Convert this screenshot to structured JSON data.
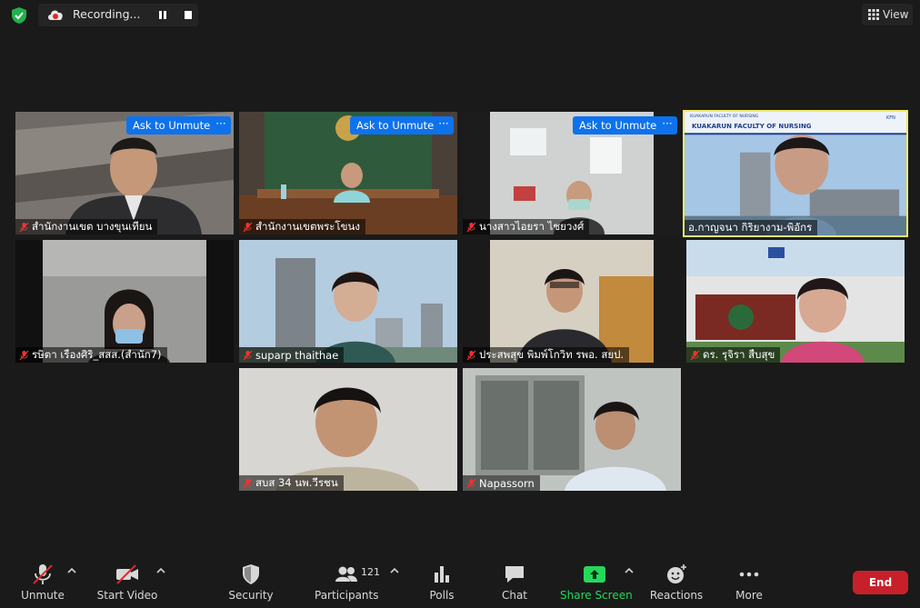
{
  "topbar": {
    "recording_label": "Recording...",
    "view_label": "View"
  },
  "ask_unmute_label": "Ask to Unmute",
  "more_label": "···",
  "tiles": [
    {
      "name": "สำนักงานเขต บางขุนเทียน"
    },
    {
      "name": "สำนักงานเขตพระโขนง"
    },
    {
      "name": "นางสาวไอยรา ไชยวงศ์"
    },
    {
      "name": "อ.กาญจนา กิริยางาม-พิอักร",
      "banner_top": "KUAKARUN FACULTY OF NURSING",
      "banner_title": "KUAKARUN FACULTY OF NURSING",
      "banner_tag": "KFN"
    },
    {
      "name": "รษิตา เรืองศิริ_สสส.(สำนัก7)"
    },
    {
      "name": "suparp thaithae"
    },
    {
      "name": "ประสพสุข พิมพ์โกวิท รพอ. สยป."
    },
    {
      "name": "ดร. รุจิรา สืบสุข"
    },
    {
      "name": "สบส 34 นพ.วีรชน"
    },
    {
      "name": "Napassorn"
    }
  ],
  "toolbar": {
    "unmute": "Unmute",
    "start_video": "Start Video",
    "security": "Security",
    "participants": "Participants",
    "participants_count": "121",
    "polls": "Polls",
    "chat": "Chat",
    "share_screen": "Share Screen",
    "reactions": "Reactions",
    "more": "More",
    "end": "End"
  },
  "colors": {
    "accent_blue": "#0e72ed",
    "share_green": "#23d959",
    "end_red": "#c8202a",
    "active_speaker": "#f1e96a"
  }
}
